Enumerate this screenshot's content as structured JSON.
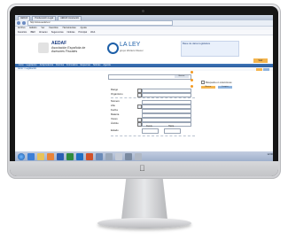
{
  "browser": {
    "tabs": [
      "AEDAF",
      "Ponderación Legal",
      "AEDAF Asociación"
    ],
    "url": "http://www.aedaf.es/",
    "menu": [
      "Archivo",
      "Edición",
      "Ver",
      "Favoritos",
      "Herramientas",
      "Ayuda"
    ],
    "favorites": [
      "Favoritos",
      "IBEX",
      "Almacén",
      "Sugerencias",
      "Noticias",
      "Principal",
      "Web"
    ]
  },
  "header": {
    "org_name": "AEDAF",
    "org_subtitle": "Asociación Española de Asesores Fiscales",
    "partner_name": "LA LEY",
    "partner_tagline": "grupo Wolters Kluwer",
    "promo_text": "Base de datos legislativa",
    "orange_tab": "Salir"
  },
  "nav": {
    "items": [
      "Inicio",
      "Legislación",
      "Jurisprudencia",
      "Doctrina",
      "Formularios",
      "Esquemas",
      "Noticias",
      "Agenda"
    ],
    "breadcrumb": "Inicio > Legislación"
  },
  "form": {
    "search_button": "Buscar",
    "check_label": "Búsqueda en colecciones",
    "btn_search": "Buscar",
    "btn_clear": "Limpiar",
    "fields": [
      "Rango",
      "Organismo",
      "Número",
      "Año",
      "Fecha",
      "Materia",
      "Voces"
    ],
    "date_from": "Desde",
    "date_to": "Hasta",
    "extra_fields": [
      "Ámbito",
      "Estado"
    ]
  },
  "taskbar": {
    "clock": "12:00"
  },
  "colors": {
    "brand_blue": "#1e3f84",
    "accent_orange": "#f39a22",
    "nav_blue": "#2d5e9e"
  }
}
